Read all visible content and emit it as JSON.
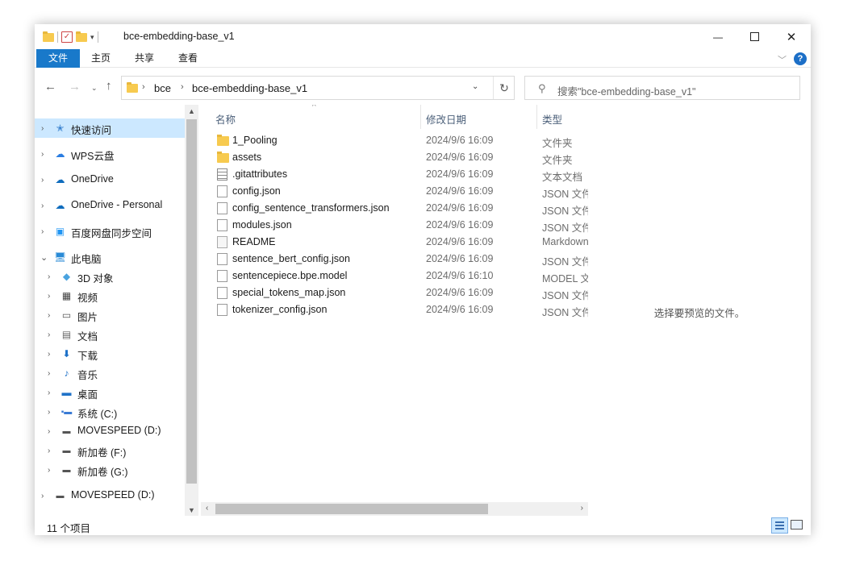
{
  "window": {
    "title": "bce-embedding-base_v1",
    "controls": {
      "minimize": "—",
      "maximize": "☐",
      "close": "✕"
    }
  },
  "ribbon": {
    "tabs": [
      "文件",
      "主页",
      "共享",
      "查看"
    ],
    "help": "?"
  },
  "address": {
    "crumbs": [
      "bce",
      "bce-embedding-base_v1"
    ],
    "search_placeholder": "搜索\"bce-embedding-base_v1\""
  },
  "nav": {
    "items": [
      {
        "label": "快速访问",
        "icon": "star-pin-icon"
      },
      {
        "label": "WPS云盘",
        "icon": "cloud-icon"
      },
      {
        "label": "OneDrive",
        "icon": "onedrive-icon"
      },
      {
        "label": "OneDrive - Personal",
        "icon": "onedrive-icon"
      },
      {
        "label": "百度网盘同步空间",
        "icon": "baidu-sync-icon"
      },
      {
        "label": "此电脑",
        "icon": "computer-icon"
      },
      {
        "label": "3D 对象",
        "icon": "3d-objects-icon"
      },
      {
        "label": "视频",
        "icon": "video-icon"
      },
      {
        "label": "图片",
        "icon": "pictures-icon"
      },
      {
        "label": "文档",
        "icon": "documents-icon"
      },
      {
        "label": "下载",
        "icon": "download-icon"
      },
      {
        "label": "音乐",
        "icon": "music-icon"
      },
      {
        "label": "桌面",
        "icon": "desktop-icon"
      },
      {
        "label": "系统 (C:)",
        "icon": "system-drive-icon"
      },
      {
        "label": "MOVESPEED (D:)",
        "icon": "drive-icon"
      },
      {
        "label": "新加卷 (F:)",
        "icon": "drive-icon"
      },
      {
        "label": "新加卷 (G:)",
        "icon": "drive-icon"
      },
      {
        "label": "MOVESPEED (D:)",
        "icon": "drive-icon"
      }
    ]
  },
  "files": {
    "columns": {
      "name": "名称",
      "date": "修改日期",
      "type": "类型"
    },
    "rows": [
      {
        "name": "1_Pooling",
        "date": "2024/9/6 16:09",
        "type": "文件夹",
        "icon": "folder-icon"
      },
      {
        "name": "assets",
        "date": "2024/9/6 16:09",
        "type": "文件夹",
        "icon": "folder-icon"
      },
      {
        "name": ".gitattributes",
        "date": "2024/9/6 16:09",
        "type": "文本文档",
        "icon": "text-file-icon"
      },
      {
        "name": "config.json",
        "date": "2024/9/6 16:09",
        "type": "JSON 文件",
        "icon": "file-icon"
      },
      {
        "name": "config_sentence_transformers.json",
        "date": "2024/9/6 16:09",
        "type": "JSON 文件",
        "icon": "file-icon"
      },
      {
        "name": "modules.json",
        "date": "2024/9/6 16:09",
        "type": "JSON 文件",
        "icon": "file-icon"
      },
      {
        "name": "README",
        "date": "2024/9/6 16:09",
        "type": "Markdown",
        "icon": "markdown-file-icon"
      },
      {
        "name": "sentence_bert_config.json",
        "date": "2024/9/6 16:09",
        "type": "JSON 文件",
        "icon": "file-icon"
      },
      {
        "name": "sentencepiece.bpe.model",
        "date": "2024/9/6 16:10",
        "type": "MODEL 文件",
        "icon": "file-icon"
      },
      {
        "name": "special_tokens_map.json",
        "date": "2024/9/6 16:09",
        "type": "JSON 文件",
        "icon": "file-icon"
      },
      {
        "name": "tokenizer_config.json",
        "date": "2024/9/6 16:09",
        "type": "JSON 文件",
        "icon": "file-icon"
      }
    ]
  },
  "preview": {
    "empty_text": "选择要预览的文件。"
  },
  "status": {
    "count": "11 个项目"
  },
  "colors": {
    "accent": "#1979ca",
    "selection": "#cce8ff",
    "folder": "#f7ca4f"
  }
}
